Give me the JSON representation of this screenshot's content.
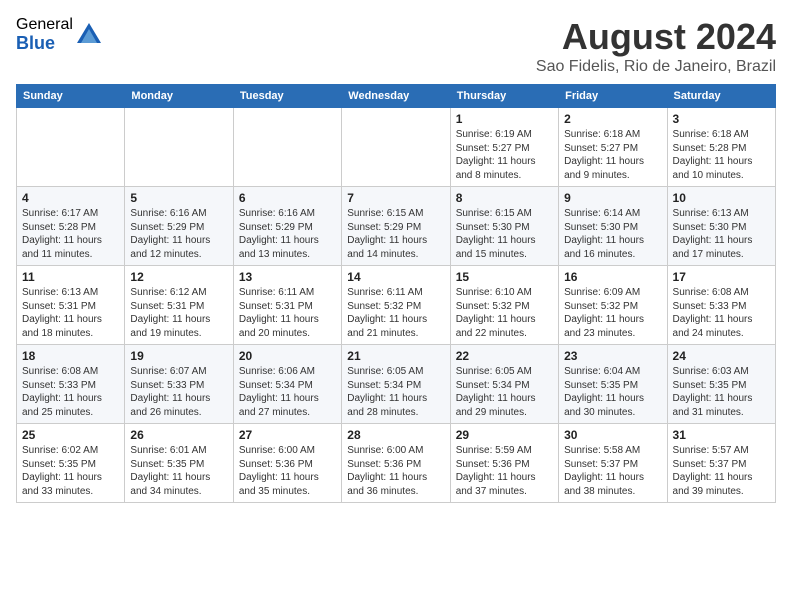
{
  "header": {
    "logo_general": "General",
    "logo_blue": "Blue",
    "month_title": "August 2024",
    "location": "Sao Fidelis, Rio de Janeiro, Brazil"
  },
  "weekdays": [
    "Sunday",
    "Monday",
    "Tuesday",
    "Wednesday",
    "Thursday",
    "Friday",
    "Saturday"
  ],
  "weeks": [
    [
      {
        "day": "",
        "info": ""
      },
      {
        "day": "",
        "info": ""
      },
      {
        "day": "",
        "info": ""
      },
      {
        "day": "",
        "info": ""
      },
      {
        "day": "1",
        "info": "Sunrise: 6:19 AM\nSunset: 5:27 PM\nDaylight: 11 hours\nand 8 minutes."
      },
      {
        "day": "2",
        "info": "Sunrise: 6:18 AM\nSunset: 5:27 PM\nDaylight: 11 hours\nand 9 minutes."
      },
      {
        "day": "3",
        "info": "Sunrise: 6:18 AM\nSunset: 5:28 PM\nDaylight: 11 hours\nand 10 minutes."
      }
    ],
    [
      {
        "day": "4",
        "info": "Sunrise: 6:17 AM\nSunset: 5:28 PM\nDaylight: 11 hours\nand 11 minutes."
      },
      {
        "day": "5",
        "info": "Sunrise: 6:16 AM\nSunset: 5:29 PM\nDaylight: 11 hours\nand 12 minutes."
      },
      {
        "day": "6",
        "info": "Sunrise: 6:16 AM\nSunset: 5:29 PM\nDaylight: 11 hours\nand 13 minutes."
      },
      {
        "day": "7",
        "info": "Sunrise: 6:15 AM\nSunset: 5:29 PM\nDaylight: 11 hours\nand 14 minutes."
      },
      {
        "day": "8",
        "info": "Sunrise: 6:15 AM\nSunset: 5:30 PM\nDaylight: 11 hours\nand 15 minutes."
      },
      {
        "day": "9",
        "info": "Sunrise: 6:14 AM\nSunset: 5:30 PM\nDaylight: 11 hours\nand 16 minutes."
      },
      {
        "day": "10",
        "info": "Sunrise: 6:13 AM\nSunset: 5:30 PM\nDaylight: 11 hours\nand 17 minutes."
      }
    ],
    [
      {
        "day": "11",
        "info": "Sunrise: 6:13 AM\nSunset: 5:31 PM\nDaylight: 11 hours\nand 18 minutes."
      },
      {
        "day": "12",
        "info": "Sunrise: 6:12 AM\nSunset: 5:31 PM\nDaylight: 11 hours\nand 19 minutes."
      },
      {
        "day": "13",
        "info": "Sunrise: 6:11 AM\nSunset: 5:31 PM\nDaylight: 11 hours\nand 20 minutes."
      },
      {
        "day": "14",
        "info": "Sunrise: 6:11 AM\nSunset: 5:32 PM\nDaylight: 11 hours\nand 21 minutes."
      },
      {
        "day": "15",
        "info": "Sunrise: 6:10 AM\nSunset: 5:32 PM\nDaylight: 11 hours\nand 22 minutes."
      },
      {
        "day": "16",
        "info": "Sunrise: 6:09 AM\nSunset: 5:32 PM\nDaylight: 11 hours\nand 23 minutes."
      },
      {
        "day": "17",
        "info": "Sunrise: 6:08 AM\nSunset: 5:33 PM\nDaylight: 11 hours\nand 24 minutes."
      }
    ],
    [
      {
        "day": "18",
        "info": "Sunrise: 6:08 AM\nSunset: 5:33 PM\nDaylight: 11 hours\nand 25 minutes."
      },
      {
        "day": "19",
        "info": "Sunrise: 6:07 AM\nSunset: 5:33 PM\nDaylight: 11 hours\nand 26 minutes."
      },
      {
        "day": "20",
        "info": "Sunrise: 6:06 AM\nSunset: 5:34 PM\nDaylight: 11 hours\nand 27 minutes."
      },
      {
        "day": "21",
        "info": "Sunrise: 6:05 AM\nSunset: 5:34 PM\nDaylight: 11 hours\nand 28 minutes."
      },
      {
        "day": "22",
        "info": "Sunrise: 6:05 AM\nSunset: 5:34 PM\nDaylight: 11 hours\nand 29 minutes."
      },
      {
        "day": "23",
        "info": "Sunrise: 6:04 AM\nSunset: 5:35 PM\nDaylight: 11 hours\nand 30 minutes."
      },
      {
        "day": "24",
        "info": "Sunrise: 6:03 AM\nSunset: 5:35 PM\nDaylight: 11 hours\nand 31 minutes."
      }
    ],
    [
      {
        "day": "25",
        "info": "Sunrise: 6:02 AM\nSunset: 5:35 PM\nDaylight: 11 hours\nand 33 minutes."
      },
      {
        "day": "26",
        "info": "Sunrise: 6:01 AM\nSunset: 5:35 PM\nDaylight: 11 hours\nand 34 minutes."
      },
      {
        "day": "27",
        "info": "Sunrise: 6:00 AM\nSunset: 5:36 PM\nDaylight: 11 hours\nand 35 minutes."
      },
      {
        "day": "28",
        "info": "Sunrise: 6:00 AM\nSunset: 5:36 PM\nDaylight: 11 hours\nand 36 minutes."
      },
      {
        "day": "29",
        "info": "Sunrise: 5:59 AM\nSunset: 5:36 PM\nDaylight: 11 hours\nand 37 minutes."
      },
      {
        "day": "30",
        "info": "Sunrise: 5:58 AM\nSunset: 5:37 PM\nDaylight: 11 hours\nand 38 minutes."
      },
      {
        "day": "31",
        "info": "Sunrise: 5:57 AM\nSunset: 5:37 PM\nDaylight: 11 hours\nand 39 minutes."
      }
    ]
  ]
}
